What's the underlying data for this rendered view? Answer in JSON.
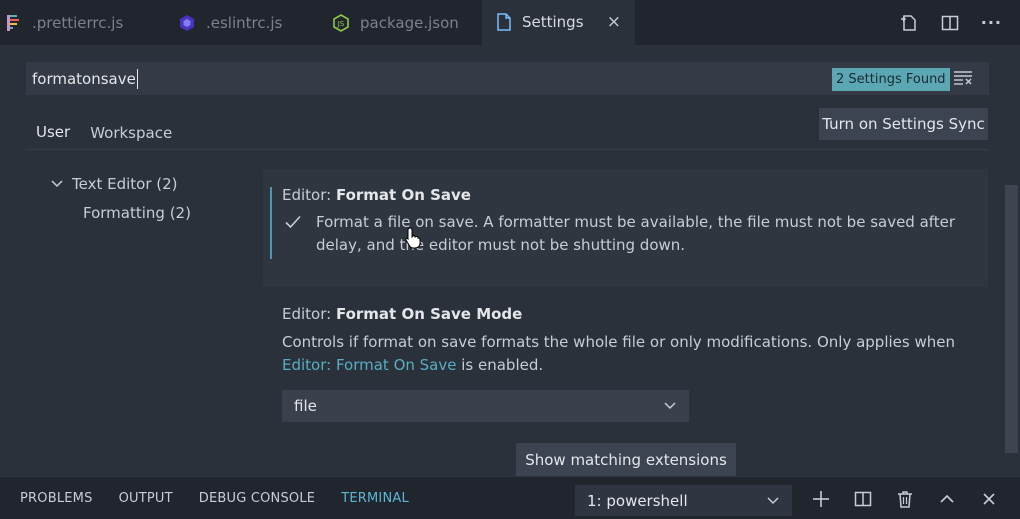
{
  "tabs": [
    {
      "label": ".prettierrc.js",
      "icon": "prettier-file-icon"
    },
    {
      "label": ".eslintrc.js",
      "icon": "eslint-file-icon"
    },
    {
      "label": "package.json",
      "icon": "nodejs-file-icon"
    },
    {
      "label": "Settings",
      "icon": "settings-file-icon",
      "active": true,
      "close": "×"
    }
  ],
  "tab_actions": [
    "open-settings-json-icon",
    "split-editor-icon",
    "more-actions-icon"
  ],
  "tab_actions_more": "···",
  "search": {
    "query": "formatonsave",
    "results_badge": "2 Settings Found",
    "clear_icon": "clear-filter-icon"
  },
  "scopes": {
    "user": "User",
    "workspace": "Workspace"
  },
  "sync_button": "Turn on Settings Sync",
  "toc": {
    "text_editor": "Text Editor (2)",
    "formatting": "Formatting (2)"
  },
  "setting_format_on_save": {
    "category": "Editor: ",
    "name": "Format On Save",
    "checked": true,
    "description": "Format a file on save. A formatter must be available, the file must not be saved after delay, and the editor must not be shutting down."
  },
  "setting_format_on_save_mode": {
    "category": "Editor: ",
    "name": "Format On Save Mode",
    "description_before": "Controls if format on save formats the whole file or only modifications. Only applies when ",
    "description_link": "Editor: Format On Save",
    "description_after": " is enabled.",
    "value": "file"
  },
  "extensions_button": "Show matching extensions",
  "panel": {
    "tabs": [
      "PROBLEMS",
      "OUTPUT",
      "DEBUG CONSOLE",
      "TERMINAL"
    ],
    "active_tab": "TERMINAL",
    "terminal_select": "1: powershell",
    "actions": [
      "new-terminal-icon",
      "split-terminal-icon",
      "kill-terminal-icon",
      "maximize-panel-icon",
      "close-panel-icon"
    ]
  },
  "colors": {
    "accent_link": "#56aec2",
    "active_panel_tab": "#5ab8d0",
    "badge_bg": "#5ba7b3",
    "modified_bar": "#4b96b3"
  }
}
